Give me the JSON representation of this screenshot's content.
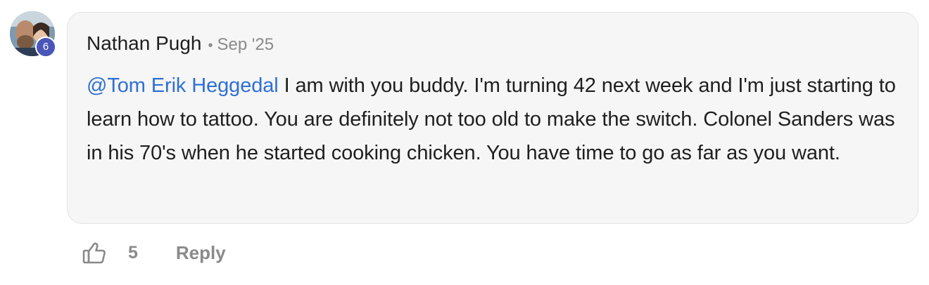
{
  "comment": {
    "author": "Nathan Pugh",
    "separator": "•",
    "date": "Sep '25",
    "level_badge": "6",
    "mention": "@Tom Erik Heggedal",
    "text": " I am with you buddy. I'm turning 42 next week and I'm just starting to learn how to tattoo. You are definitely not too old to make the switch. Colonel Sanders was in his 70's when he started cooking chicken. You have time to go as far as you want."
  },
  "actions": {
    "like_icon": "thumbs-up-icon",
    "like_count": "5",
    "reply_label": "Reply"
  },
  "colors": {
    "mention": "#2f6fd6",
    "badge": "#4a56b8",
    "bubble": "#f6f6f6",
    "muted": "#8a8a8a"
  }
}
